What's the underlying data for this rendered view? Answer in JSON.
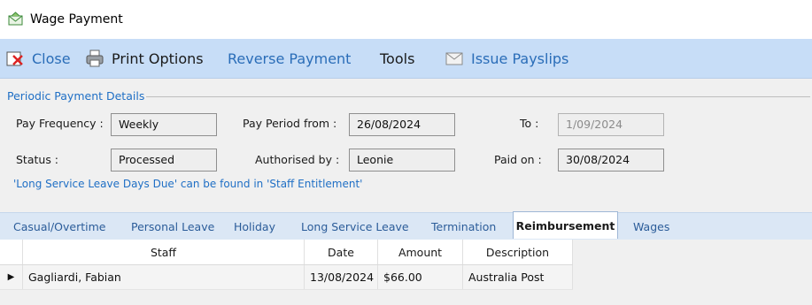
{
  "window": {
    "title": "Wage Payment"
  },
  "toolbar": {
    "close_label": "Close",
    "print_label": "Print Options",
    "reverse_label": "Reverse Payment",
    "tools_label": "Tools",
    "payslips_label": "Issue Payslips"
  },
  "details": {
    "group_title": "Periodic Payment Details",
    "pay_frequency_label": "Pay Frequency :",
    "pay_frequency_value": "Weekly",
    "pay_period_from_label": "Pay Period from :",
    "pay_period_from_value": "26/08/2024",
    "to_label": "To :",
    "to_value": "1/09/2024",
    "status_label": "Status :",
    "status_value": "Processed",
    "authorised_by_label": "Authorised by :",
    "authorised_by_value": "Leonie",
    "paid_on_label": "Paid on :",
    "paid_on_value": "30/08/2024",
    "note": "'Long Service Leave Days Due' can be found in 'Staff Entitlement'"
  },
  "tabs": [
    {
      "label": "Casual/Overtime"
    },
    {
      "label": "Personal Leave"
    },
    {
      "label": "Holiday"
    },
    {
      "label": "Long Service Leave"
    },
    {
      "label": "Termination"
    },
    {
      "label": "Reimbursement",
      "active": true
    },
    {
      "label": "Wages"
    }
  ],
  "grid": {
    "columns": [
      "Staff",
      "Date",
      "Amount",
      "Description"
    ],
    "rows": [
      {
        "indicator": "▶",
        "staff": "Gagliardi, Fabian",
        "date": "13/08/2024",
        "amount": "$66.00",
        "description": "Australia Post"
      }
    ]
  },
  "icons": {
    "app": "envelope-icon",
    "close": "close-icon",
    "print": "printer-icon",
    "payslips": "envelope-icon"
  },
  "colors": {
    "toolbar_bg": "#c7ddf7",
    "accent_blue": "#1f6fc5",
    "tab_bg": "#dbe7f5"
  }
}
